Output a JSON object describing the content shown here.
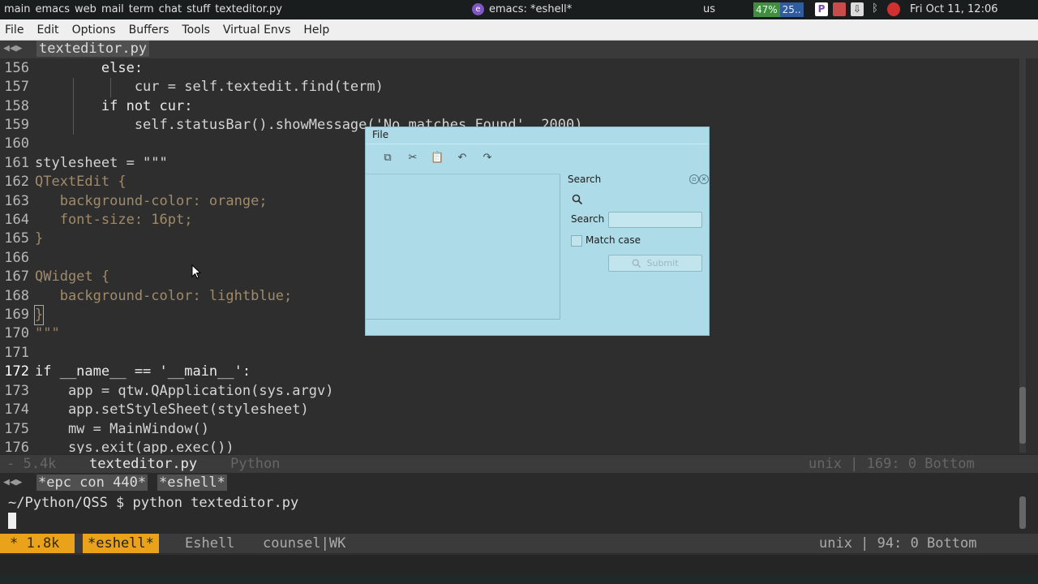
{
  "topbar": {
    "workspaces": [
      "main",
      "emacs",
      "web",
      "mail",
      "term",
      "chat",
      "stuff",
      "texteditor.py"
    ],
    "window_title": "emacs: *eshell*",
    "keyboard_layout": "us",
    "battery_percent": "47%",
    "battery_extra": "25..",
    "clock": "Fri Oct 11, 12:06"
  },
  "menubar": [
    "File",
    "Edit",
    "Options",
    "Buffers",
    "Tools",
    "Virtual Envs",
    "Help"
  ],
  "editor": {
    "tab_arrows": "◀◀▶",
    "tab_name": "texteditor.py",
    "lines": [
      {
        "n": "156",
        "code": "        else:"
      },
      {
        "n": "157",
        "code": "            cur = self.textedit.find(term)"
      },
      {
        "n": "158",
        "code": "        if not cur:"
      },
      {
        "n": "159",
        "code": "            self.statusBar().showMessage('No matches Found', 2000)"
      },
      {
        "n": "160",
        "code": ""
      },
      {
        "n": "161",
        "code": "stylesheet = \"\"\""
      },
      {
        "n": "162",
        "code": "QTextEdit {"
      },
      {
        "n": "163",
        "code": "   background-color: orange;"
      },
      {
        "n": "164",
        "code": "   font-size: 16pt;"
      },
      {
        "n": "165",
        "code": "}"
      },
      {
        "n": "166",
        "code": ""
      },
      {
        "n": "167",
        "code": "QWidget {"
      },
      {
        "n": "168",
        "code": "   background-color: lightblue;"
      },
      {
        "n": "169",
        "code": "}"
      },
      {
        "n": "170",
        "code": "\"\"\""
      },
      {
        "n": "171",
        "code": ""
      },
      {
        "n": "172",
        "code": "if __name__ == '__main__':"
      },
      {
        "n": "173",
        "code": "    app = qtw.QApplication(sys.argv)"
      },
      {
        "n": "174",
        "code": "    app.setStyleSheet(stylesheet)"
      },
      {
        "n": "175",
        "code": "    mw = MainWindow()"
      },
      {
        "n": "176",
        "code": "    sys.exit(app.exec())"
      }
    ],
    "modeline": {
      "left": "- 5.4k",
      "buffer": "texteditor.py",
      "major_mode": "Python",
      "right": "unix | 169: 0   Bottom"
    }
  },
  "eshell": {
    "tab_arrows": "◀◀▶",
    "tab1": "*epc con 440*",
    "tab2": "*eshell*",
    "prompt": "~/Python/QSS $ python texteditor.py",
    "modeline": {
      "state": "* 1.8k",
      "buffer": "*eshell*",
      "major_mode": "Eshell",
      "minor_mode": "counsel|WK",
      "right": "unix | 94: 0   Bottom"
    }
  },
  "qt_window": {
    "menu": "File",
    "toolbar": [
      "copy-icon",
      "cut-icon",
      "paste-icon",
      "undo-icon",
      "redo-icon"
    ],
    "dock_title": "Search",
    "search_label": "Search",
    "search_value": "",
    "match_case_label": "Match case",
    "match_case_checked": false,
    "submit_label": "Submit",
    "background": "#aedbe8"
  }
}
